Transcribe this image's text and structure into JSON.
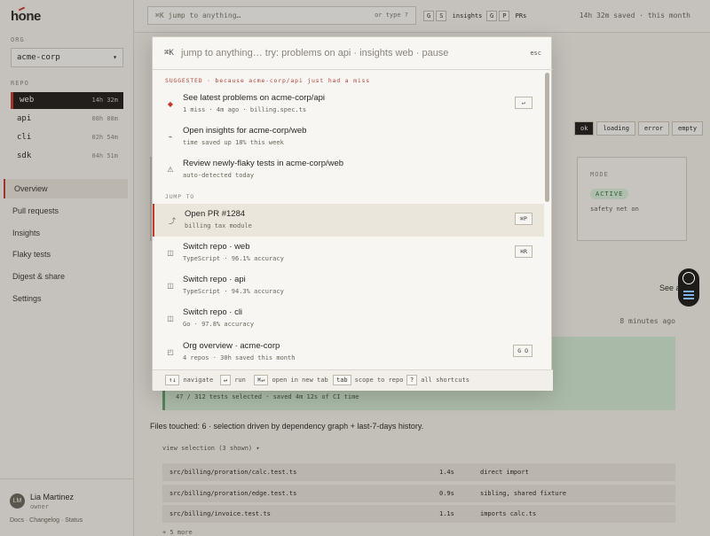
{
  "app": {
    "logo": "hone"
  },
  "sidebar": {
    "org_label": "ORG",
    "org_value": "acme-corp",
    "repo_label": "REPO",
    "repos": [
      {
        "name": "web",
        "time": "14h 32m"
      },
      {
        "name": "api",
        "time": "08h 08m"
      },
      {
        "name": "cli",
        "time": "02h 54m"
      },
      {
        "name": "sdk",
        "time": "04h 51m"
      }
    ],
    "nav": [
      "Overview",
      "Pull requests",
      "Insights",
      "Flaky tests",
      "Digest & share",
      "Settings"
    ],
    "user": {
      "initials": "LM",
      "name": "Lia Martinez",
      "role": "owner",
      "links": "Docs · Changelog · Status"
    }
  },
  "topbar": {
    "search_placeholder": "⌘K  jump to anything…",
    "search_hint": "or type ?",
    "shortcut_insights_keys": [
      "G",
      "S"
    ],
    "shortcut_insights_label": "insights",
    "shortcut_prs_keys": [
      "G",
      "P"
    ],
    "shortcut_prs_label": "PRs",
    "saved": "14h 32m saved · this month"
  },
  "main": {
    "states": [
      "ok",
      "loading",
      "error",
      "empty"
    ],
    "mode_label": "MODE",
    "mode_value": "ACTIVE",
    "mode_desc": "safety net on",
    "see_all": "See all",
    "ago": "8 minutes ago",
    "tests_selected": "47 / 312 tests selected · saved 4m 12s of CI time",
    "files_touched": "Files touched: 6 · selection driven by dependency graph + last-7-days history.",
    "view_selection": "view selection (3 shown) ▾",
    "rows": [
      {
        "path": "src/billing/proration/calc.test.ts",
        "time": "1.4s",
        "reason": "direct import"
      },
      {
        "path": "src/billing/proration/edge.test.ts",
        "time": "0.9s",
        "reason": "sibling, shared fixture"
      },
      {
        "path": "src/billing/invoice.test.ts",
        "time": "1.1s",
        "reason": "imports calc.ts"
      }
    ],
    "more": "+ 5 more"
  },
  "palette": {
    "cmd_glyph": "⌘K",
    "input_placeholder": "jump to anything…  try:  problems on api  ·  insights web  ·  pause",
    "esc": "esc",
    "suggested_label": "SUGGESTED · because acme-corp/api just had a miss",
    "jump_label": "JUMP TO",
    "items": [
      {
        "icon": "◆",
        "title": "See latest problems on acme-corp/api",
        "sub": "1 miss · 4m ago · billing.spec.ts",
        "key": "↵"
      },
      {
        "icon": "⌁",
        "title": "Open insights for acme-corp/web",
        "sub": "time saved up 18% this week",
        "key": ""
      },
      {
        "icon": "⚠",
        "title": "Review newly-flaky tests in acme-corp/web",
        "sub": "auto-detected today",
        "key": ""
      },
      {
        "icon": "⤴",
        "title": "Open PR #1284",
        "sub": "billing tax module",
        "key": "⌘P"
      },
      {
        "icon": "◫",
        "title": "Switch repo · web",
        "sub": "TypeScript · 96.1% accuracy",
        "key": "⌘R"
      },
      {
        "icon": "◫",
        "title": "Switch repo · api",
        "sub": "TypeScript · 94.3% accuracy",
        "key": ""
      },
      {
        "icon": "◫",
        "title": "Switch repo · cli",
        "sub": "Go · 97.8% accuracy",
        "key": ""
      },
      {
        "icon": "◰",
        "title": "Org overview · acme-corp",
        "sub": "4 repos · 30h saved this month",
        "key": "G O"
      }
    ],
    "footer": [
      {
        "key": "↑↓",
        "label": "navigate"
      },
      {
        "key": "↵",
        "label": "run"
      },
      {
        "key": "⌘↵",
        "label": "open in new tab"
      },
      {
        "key": "tab",
        "label": "scope to repo"
      },
      {
        "key": "?",
        "label": "all shortcuts"
      }
    ]
  }
}
